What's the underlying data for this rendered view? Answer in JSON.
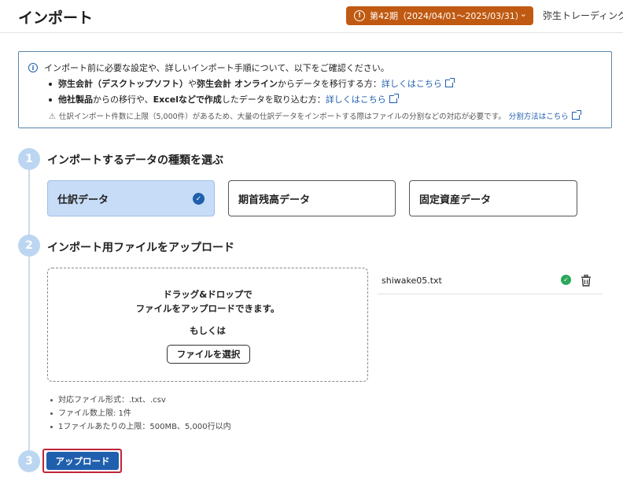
{
  "header": {
    "title": "インポート",
    "period_label": "第42期（2024/04/01〜2025/03/31）",
    "company_name": "弥生トレーディング"
  },
  "notice": {
    "intro": "インポート前に必要な設定や、詳しいインポート手順について、以下をご確認ください。",
    "bullet1_bold1": "弥生会計（デスクトップソフト）",
    "bullet1_mid": "や",
    "bullet1_bold2": "弥生会計 オンライン",
    "bullet1_rest": "からデータを移行する方：",
    "bullet1_link": "詳しくはこちら",
    "bullet2_bold1": "他社製品",
    "bullet2_mid": "からの移行や、",
    "bullet2_bold2": "Excelなどで作成",
    "bullet2_rest": "したデータを取り込む方：",
    "bullet2_link": "詳しくはこちら",
    "warning": "仕訳インポート件数に上限（5,000件）があるため、大量の仕訳データをインポートする際はファイルの分割などの対応が必要です。",
    "warning_link": "分割方法はこちら"
  },
  "steps": [
    {
      "number": "1",
      "title": "インポートするデータの種類を選ぶ"
    },
    {
      "number": "2",
      "title": "インポート用ファイルをアップロード"
    },
    {
      "number": "3"
    }
  ],
  "data_types": [
    {
      "label": "仕訳データ",
      "selected": true
    },
    {
      "label": "期首残高データ",
      "selected": false
    },
    {
      "label": "固定資産データ",
      "selected": false
    }
  ],
  "dropzone": {
    "line1": "ドラッグ&ドロップで",
    "line2": "ファイルをアップロードできます。",
    "or": "もしくは",
    "select_button": "ファイルを選択"
  },
  "uploaded_file": {
    "name": "shiwake05.txt",
    "status": "ok"
  },
  "requirements": [
    "対応ファイル形式：.txt、.csv",
    "ファイル数上限: 1件",
    "1ファイルあたりの上限：500MB、5,000行以内"
  ],
  "upload_button": "アップロード",
  "colors": {
    "accent": "#1f5fae",
    "period_badge": "#c05a12",
    "selected_card": "#c7dcf6",
    "step_circle": "#bcd6f2",
    "success": "#2aa85a",
    "highlight_outline": "#c0243a"
  }
}
